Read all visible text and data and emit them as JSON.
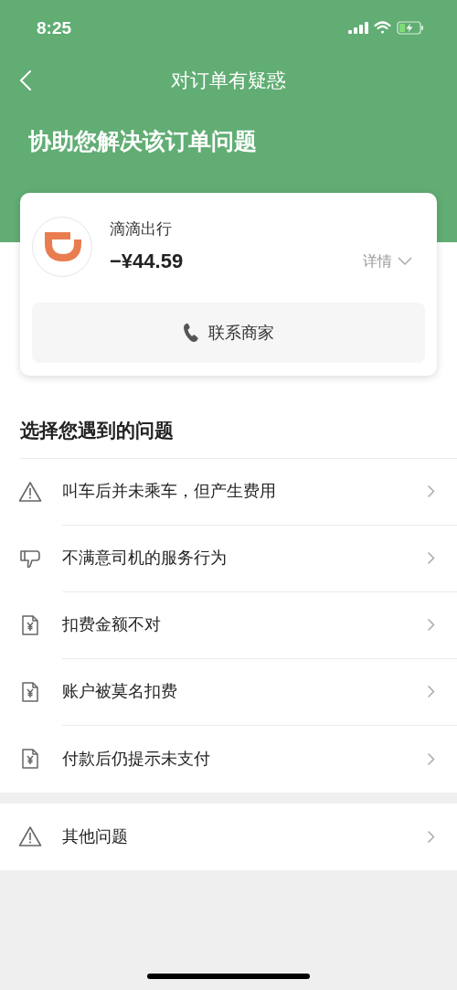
{
  "status_bar": {
    "time": "8:25"
  },
  "nav": {
    "title": "对订单有疑惑"
  },
  "header": {
    "subtitle": "协助您解决该订单问题"
  },
  "order_card": {
    "merchant": "滴滴出行",
    "amount": "−¥44.59",
    "details_label": "详情",
    "contact_button": "联系商家"
  },
  "section_title": "选择您遇到的问题",
  "problems": [
    {
      "kind": "warning",
      "label": "叫车后并未乘车，但产生费用"
    },
    {
      "kind": "thumbs-down",
      "label": "不满意司机的服务行为"
    },
    {
      "kind": "receipt",
      "label": "扣费金额不对"
    },
    {
      "kind": "receipt",
      "label": "账户被莫名扣费"
    },
    {
      "kind": "receipt",
      "label": "付款后仍提示未支付"
    }
  ],
  "other_problems": [
    {
      "kind": "warning",
      "label": "其他问题"
    }
  ]
}
